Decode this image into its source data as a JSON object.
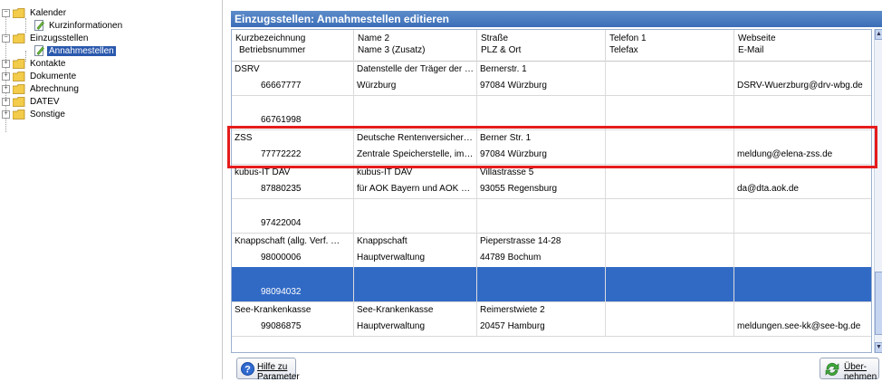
{
  "tree": {
    "items": [
      {
        "label": "Kalender",
        "expander": "−",
        "icon": "folder-icon"
      },
      {
        "label": "Kurzinformationen",
        "icon": "document-pencil-icon"
      },
      {
        "label": "Einzugsstellen",
        "expander": "−",
        "icon": "folder-icon"
      },
      {
        "label": "Annahmestellen",
        "icon": "document-pencil-icon",
        "selected": true
      },
      {
        "label": "Kontakte",
        "expander": "+",
        "icon": "folder-icon"
      },
      {
        "label": "Dokumente",
        "expander": "+",
        "icon": "folder-icon"
      },
      {
        "label": "Abrechnung",
        "expander": "+",
        "icon": "folder-icon"
      },
      {
        "label": "DATEV",
        "expander": "+",
        "icon": "folder-icon"
      },
      {
        "label": "Sonstige",
        "expander": "+",
        "icon": "folder-icon"
      }
    ]
  },
  "panel": {
    "title": "Einzugsstellen: Annahmestellen editieren"
  },
  "table": {
    "columns": [
      {
        "line1": "Kurzbezeichnung",
        "line2": "Betriebsnummer"
      },
      {
        "line1": "Name 2",
        "line2": "Name 3 (Zusatz)"
      },
      {
        "line1": "Straße",
        "line2": "PLZ & Ort"
      },
      {
        "line1": "Telefon 1",
        "line2": "Telefax"
      },
      {
        "line1": "Webseite",
        "line2": "E-Mail"
      }
    ],
    "rows": [
      {
        "kurz": "DSRV",
        "nr": "66667777",
        "name2": "Datenstelle der Träger der …",
        "name3": "Würzburg",
        "strasse": "Bernerstr. 1",
        "ort": "97084 Würzburg",
        "tel": "",
        "fax": "",
        "web": "",
        "email": "DSRV-Wuerzburg@drv-wbg.de"
      },
      {
        "kurz": "",
        "nr": "66761998",
        "name2": "",
        "name3": "",
        "strasse": "",
        "ort": "",
        "tel": "",
        "fax": "",
        "web": "",
        "email": ""
      },
      {
        "kurz": "ZSS",
        "nr": "77772222",
        "name2": "Deutsche Rentenversicher…",
        "name3": "Zentrale Speicherstelle, im …",
        "strasse": "Berner Str. 1",
        "ort": "97084 Würzburg",
        "tel": "",
        "fax": "",
        "web": "",
        "email": "meldung@elena-zss.de"
      },
      {
        "kurz": "kubus-IT DAV",
        "nr": "87880235",
        "name2": "kubus-IT DAV",
        "name3": "für AOK Bayern und AOK P…",
        "strasse": "Villastrasse 5",
        "ort": "93055 Regensburg",
        "tel": "",
        "fax": "",
        "web": "",
        "email": "da@dta.aok.de"
      },
      {
        "kurz": "",
        "nr": "97422004",
        "name2": "",
        "name3": "",
        "strasse": "",
        "ort": "",
        "tel": "",
        "fax": "",
        "web": "",
        "email": ""
      },
      {
        "kurz": "Knappschaft (allg. Verf. …",
        "nr": "98000006",
        "name2": "Knappschaft",
        "name3": "Hauptverwaltung",
        "strasse": "Pieperstrasse 14-28",
        "ort": "44789 Bochum",
        "tel": "",
        "fax": "",
        "web": "",
        "email": ""
      },
      {
        "kurz": "",
        "nr": "98094032",
        "name2": "",
        "name3": "",
        "strasse": "",
        "ort": "",
        "tel": "",
        "fax": "",
        "web": "",
        "email": "",
        "selected": true
      },
      {
        "kurz": "See-Krankenkasse",
        "nr": "99086875",
        "name2": "See-Krankenkasse",
        "name3": "Hauptverwaltung",
        "strasse": "Reimerstwiete 2",
        "ort": "20457 Hamburg",
        "tel": "",
        "fax": "",
        "web": "",
        "email": "meldungen.see-kk@see-bg.de"
      }
    ]
  },
  "buttons": {
    "help_line1": "Hilfe zu",
    "help_line2": "Parameter",
    "apply_line1": "Über-",
    "apply_line2": "nehmen"
  },
  "colors": {
    "selection": "#316ac5",
    "title_bar": "#3b6eb8",
    "highlight_frame": "#e51c1c"
  }
}
